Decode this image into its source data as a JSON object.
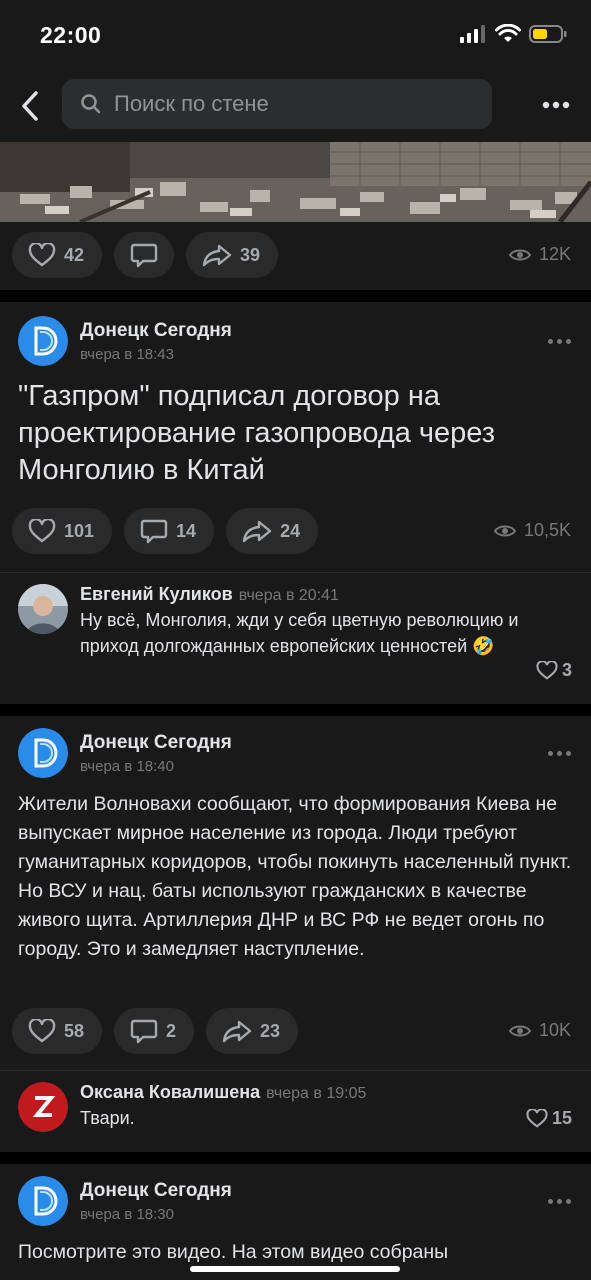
{
  "status_bar": {
    "time": "22:00"
  },
  "search": {
    "placeholder": "Поиск по стене"
  },
  "colors": {
    "background": "#000000",
    "card": "#19191a",
    "pill": "#2a2a2b",
    "text": "#e1e3e6",
    "muted": "#76787a",
    "brand_blue": "#2a8be8"
  },
  "top_post": {
    "likes": "42",
    "comments": "",
    "reposts": "39",
    "views": "12K"
  },
  "posts": [
    {
      "author": "Донецк Сегодня",
      "date": "вчера в 18:43",
      "text": "\"Газпром\" подписал договор на проектирование газопровода через Монголию в Китай",
      "likes": "101",
      "comments": "14",
      "reposts": "24",
      "views": "10,5K",
      "comment": {
        "author": "Евгений Куликов",
        "date": "вчера в 20:41",
        "text": "Ну всё, Монголия, жди у себя цветную революцию и приход долгожданных европейских ценностей 🤣",
        "likes": "3"
      }
    },
    {
      "author": "Донецк Сегодня",
      "date": "вчера в 18:40",
      "text": "Жители Волновахи сообщают, что формирования Киева не выпускает мирное население из города. Люди требуют гуманитарных коридоров, чтобы покинуть населенный пункт. Но ВСУ и нац. баты используют гражданских в качестве живого щита. Артиллерия ДНР и ВС РФ не ведет огонь по городу. Это и замедляет наступление.",
      "likes": "58",
      "comments": "2",
      "reposts": "23",
      "views": "10K",
      "comment": {
        "author": "Оксана Ковалишена",
        "date": "вчера в 19:05",
        "text": "Твари.",
        "likes": "15",
        "avatar_text": "ЗА НАШИХ"
      }
    },
    {
      "author": "Донецк Сегодня",
      "date": "вчера в 18:30",
      "text": "Посмотрите это видео. На этом видео собраны"
    }
  ]
}
